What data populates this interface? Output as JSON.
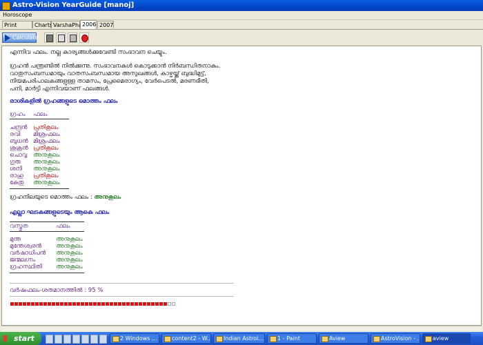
{
  "window": {
    "title": "Astro-Vision YearGuide [manoj]"
  },
  "menu": {
    "items": [
      "Horoscope"
    ]
  },
  "tabs": [
    "Print Preview",
    "Charts",
    "VarshaPhal",
    "2006",
    "2007"
  ],
  "active_tab": "2006",
  "toolbar": {
    "calculate_label": "Calculate"
  },
  "content": {
    "para1": "എന്നിവ ഫലം. നല്ല കാര്യങ്ങൾക്കുവേണ്ടി സംഭാവന ചെയ്യും.",
    "para2_lines": [
      "ഗ്രഹൻ പന്ത്രണ്ടിൽ നിൽക്കുന്നു. സംഭാവനകൾ കൊടുക്കാൻ നിർബന്ധിതനാകും.",
      "വാതുസംബന്ധമായും വാതസംബന്ധമായ അസുഖങ്ങൾ, കാഴ്ചയ്ക്ക് ബുദ്ധിമുട്ട്,",
      "നിയമപരിപാലകങ്ങളുള്ള താമസം, പ്രേമൈരാഗ്യം, വേർപെടൽ, മരണഭീതി,",
      "പനി, മാർട്ടി എന്നിവയാണ് ഫലങ്ങൾ."
    ],
    "section1": {
      "heading": "രാശികളിൽ ഗ്രഹങ്ങളുടെ മൊത്തം ഫലം",
      "col1": "ഗ്രഹം",
      "col2": "ഫലം",
      "rows": [
        {
          "name": "ചന്ദ്രൻ",
          "result": "പ്രതികൂലം",
          "type": "bad"
        },
        {
          "name": "രവി",
          "result": "മിശ്രഫലം",
          "type": "neutral"
        },
        {
          "name": "ബുധൻ",
          "result": "മിശ്രഫലം",
          "type": "neutral"
        },
        {
          "name": "ശുക്രൻ",
          "result": "പ്രതികൂലം",
          "type": "bad"
        },
        {
          "name": "ചൊവ്വ",
          "result": "അനുകൂലം",
          "type": "good"
        },
        {
          "name": "ഗുരു",
          "result": "അനുകൂലം",
          "type": "good"
        },
        {
          "name": "ശനി",
          "result": "അനുകൂലം",
          "type": "good"
        },
        {
          "name": "രാഹു",
          "result": "പ്രതികൂലം",
          "type": "bad"
        },
        {
          "name": "കേതു",
          "result": "അനുകൂലം",
          "type": "good"
        }
      ]
    },
    "summary1": {
      "label": "ഗ്രഹനിലയുടെ മൊത്തം ഫലം :",
      "value": "അനുകൂലം"
    },
    "section2": {
      "heading": "എല്ലാ ഘടകങ്ങളുടെയും ആകെ ഫലം",
      "col1": "വസ്തുത",
      "col2": "ഫലം",
      "rows": [
        {
          "name": "മുന്ത",
          "result": "അനുകൂലം"
        },
        {
          "name": "മുന്തേശ്വരൻ",
          "result": "അനുകൂലം"
        },
        {
          "name": "വർഷാധിപൻ",
          "result": "അനുകൂലം"
        },
        {
          "name": "ജന്മലഗ്നം",
          "result": "അനുകൂലം"
        },
        {
          "name": "ഗ്രഹസ്ഥിതി",
          "result": "അനുകൂലം"
        }
      ]
    },
    "percentage": {
      "label": "വർഷഫലം-ശതമാനത്തിൽ :",
      "value": "95 %",
      "fraction": 0.95
    }
  },
  "taskbar": {
    "start_label": "start",
    "items": [
      {
        "label": "2 Windows ..."
      },
      {
        "label": "content2 - W..."
      },
      {
        "label": "Indian Astrol..."
      },
      {
        "label": "1 - Paint"
      },
      {
        "label": "Aview"
      },
      {
        "label": "AstroVision - ..."
      },
      {
        "label": "aview"
      }
    ]
  },
  "colors": {
    "good": "#2b7a2b",
    "bad": "#b02020",
    "neutral": "#6a2a80",
    "heading": "#1a1aa8",
    "bar": "#e01010"
  }
}
